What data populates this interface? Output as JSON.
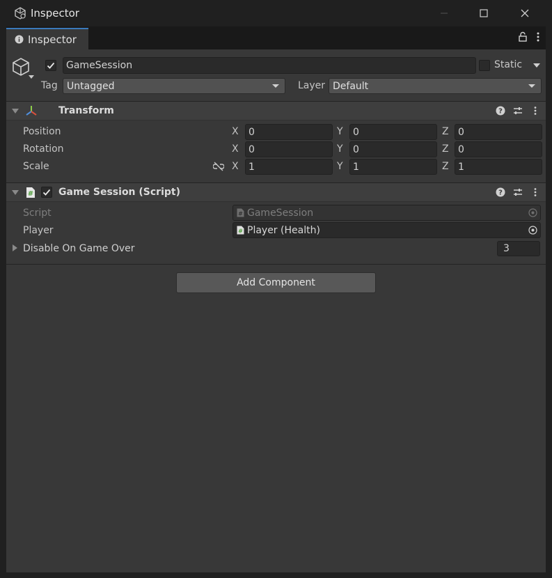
{
  "window": {
    "title": "Inspector",
    "icons": [
      "unity-icon",
      "minimize-icon",
      "maximize-icon",
      "close-icon"
    ]
  },
  "tab": {
    "label": "Inspector",
    "icons": [
      "info-icon",
      "lock-icon",
      "kebab-menu-icon"
    ]
  },
  "gameobject": {
    "active": true,
    "name": "GameSession",
    "static_checked": false,
    "static_label": "Static",
    "tag_label": "Tag",
    "tag_value": "Untagged",
    "layer_label": "Layer",
    "layer_value": "Default"
  },
  "transform": {
    "title": "Transform",
    "rows": [
      {
        "label": "Position",
        "x": "0",
        "y": "0",
        "z": "0"
      },
      {
        "label": "Rotation",
        "x": "0",
        "y": "0",
        "z": "0"
      },
      {
        "label": "Scale",
        "x": "1",
        "y": "1",
        "z": "1"
      }
    ],
    "axes": {
      "x": "X",
      "y": "Y",
      "z": "Z"
    }
  },
  "script_component": {
    "enabled": true,
    "title": "Game Session (Script)",
    "script_label": "Script",
    "script_value": "GameSession",
    "player_label": "Player",
    "player_value": "Player (Health)",
    "disable_label": "Disable On Game Over",
    "disable_count": "3"
  },
  "add_component_label": "Add Component",
  "colors": {
    "panel_bg": "#383838",
    "header_bg": "#3e3e3e",
    "field_bg": "#2a2a2a",
    "tab_accent": "#3a79bb",
    "button_bg": "#585858"
  }
}
